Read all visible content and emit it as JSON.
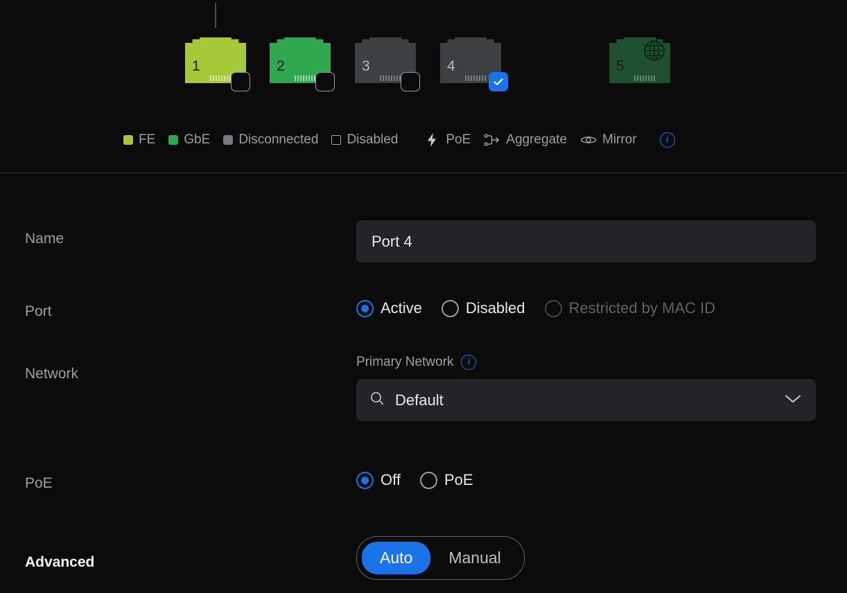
{
  "port_map": {
    "ports": [
      {
        "number": "1",
        "state": "fe",
        "state_label": "FE",
        "selected": false,
        "cable": true,
        "wan_icon": false
      },
      {
        "number": "2",
        "state": "gbe",
        "state_label": "GbE",
        "selected": false,
        "cable": false,
        "wan_icon": false
      },
      {
        "number": "3",
        "state": "disc",
        "state_label": "Disconnected",
        "selected": false,
        "cable": false,
        "wan_icon": false
      },
      {
        "number": "4",
        "state": "disc",
        "state_label": "Disconnected",
        "selected": true,
        "cable": false,
        "wan_icon": false
      },
      {
        "number": "5",
        "state": "wan",
        "state_label": "GbE",
        "selected": false,
        "cable": false,
        "wan_icon": true
      }
    ],
    "legend": {
      "fe": "FE",
      "gbe": "GbE",
      "disconnected": "Disconnected",
      "disabled": "Disabled",
      "poe": "PoE",
      "aggregate": "Aggregate",
      "mirror": "Mirror",
      "info": "i"
    }
  },
  "form": {
    "name": {
      "label": "Name",
      "value": "Port 4",
      "placeholder": "Port 4"
    },
    "port": {
      "label": "Port",
      "options": [
        {
          "label": "Active",
          "selected": true,
          "disabled": false
        },
        {
          "label": "Disabled",
          "selected": false,
          "disabled": false
        },
        {
          "label": "Restricted by MAC ID",
          "selected": false,
          "disabled": true
        }
      ]
    },
    "network": {
      "label": "Network",
      "sub_label": "Primary Network",
      "info": "i",
      "selected": "Default",
      "search_placeholder": "Default"
    },
    "poe": {
      "label": "PoE",
      "options": [
        {
          "label": "Off",
          "selected": true
        },
        {
          "label": "PoE",
          "selected": false
        }
      ]
    },
    "advanced": {
      "label": "Advanced",
      "segments": [
        {
          "label": "Auto",
          "active": true
        },
        {
          "label": "Manual",
          "active": false
        }
      ]
    }
  },
  "colors": {
    "accent": "#1a73e8",
    "fe": "#a6c939",
    "gbe": "#2fa84f",
    "disconnected": "#3c4043",
    "wan": "#1f5130",
    "background": "#0b0b0c",
    "field": "#232427"
  }
}
